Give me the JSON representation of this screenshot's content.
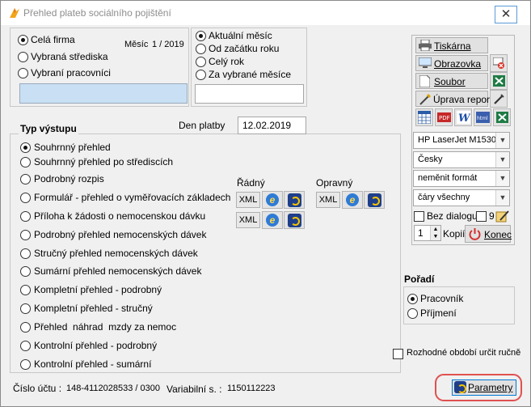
{
  "window": {
    "title": "Přehled plateb sociálního pojištění",
    "close_glyph": "✕"
  },
  "scope": {
    "options": [
      "Celá firma",
      "Vybraná střediska",
      "Vybraní pracovníci"
    ],
    "selected": 0,
    "month_label": "Měsíc",
    "month_value": "1 / 2019"
  },
  "period": {
    "options": [
      "Aktuální měsíc",
      "Od začátku roku",
      "Celý rok",
      "Za vybrané měsíce"
    ],
    "selected": 0
  },
  "output": {
    "heading": "Typ výstupu",
    "payment_date_label": "Den platby",
    "payment_date_value": "12.02.2019",
    "options": [
      "Souhrnný přehled",
      "Souhrnný přehled po střediscích",
      "Podrobný rozpis",
      "Formulář - přehled o vyměřovacích základech",
      "Příloha k žádosti o nemocenskou dávku",
      "Podrobný přehled nemocenských dávek",
      "Stručný přehled nemocenských dávek",
      "Sumární přehled nemocenských dávek",
      "Kompletní přehled - podrobný",
      "Kompletní přehled - stručný",
      "Přehled  náhrad  mzdy za nemoc",
      "Kontrolní přehled - podrobný",
      "Kontrolní přehled - sumární"
    ],
    "selected": 0
  },
  "xml": {
    "regular_label": "Řádný",
    "corrective_label": "Opravný",
    "xml_label": "XML"
  },
  "print": {
    "printer_label": "Tiskárna",
    "screen_label": "Obrazovka",
    "file_label": "Soubor",
    "edit_label": "Úprava repor",
    "export_icons": [
      "pdf",
      "word",
      "html",
      "excel"
    ]
  },
  "settings": {
    "printer": "HP LaserJet M1530",
    "language": "Česky",
    "format": "neměnit formát",
    "lines": "čáry všechny",
    "no_dialog_label": "Bez dialogu",
    "no_dialog_count": "9",
    "copies_value": "1",
    "copies_label": "Kopií",
    "end_label": "Konec"
  },
  "order": {
    "heading": "Pořadí",
    "options": [
      "Pracovník",
      "Příjmení"
    ],
    "selected": 0
  },
  "decisive_period_label": "Rozhodné období určit ručně",
  "footer": {
    "account_label": "Číslo účtu :",
    "account_value": "148-4112028533 / 0300",
    "vs_label": "Variabilní s. :",
    "vs_value": "1150112223",
    "params_label": "Parametry"
  },
  "colors": {
    "highlight_input": "#c8dff4",
    "params_ring": "#e05050",
    "accent": "#0078d7"
  }
}
